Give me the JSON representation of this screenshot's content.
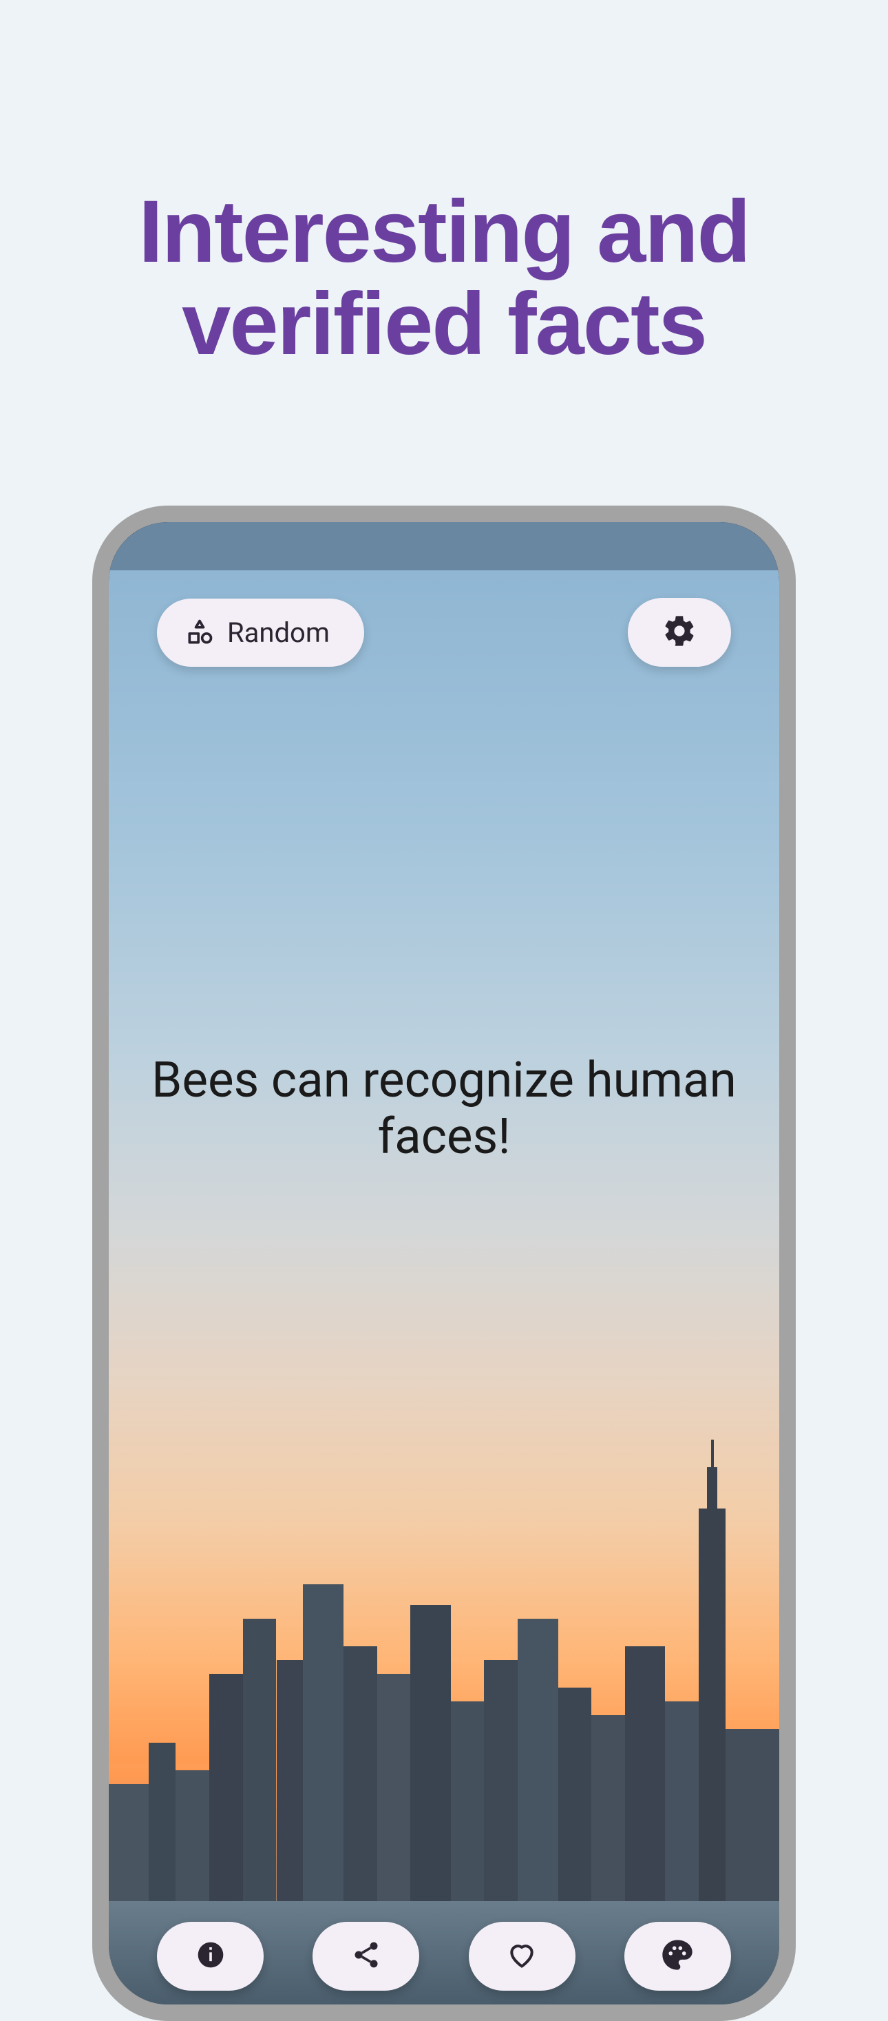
{
  "marketing": {
    "headline_line1": "Interesting and",
    "headline_line2": "verified facts"
  },
  "top": {
    "random_label": "Random"
  },
  "fact": {
    "text": "Bees can recognize human faces!"
  },
  "icons": {
    "category": "category-icon",
    "settings": "gear-icon",
    "info": "info-icon",
    "share": "share-icon",
    "favorite": "heart-icon",
    "palette": "palette-icon"
  },
  "colors": {
    "page_bg": "#edf3f6",
    "headline": "#6b3fa0",
    "pill_bg": "#f4eff7",
    "icon_fg": "#2a2530"
  }
}
